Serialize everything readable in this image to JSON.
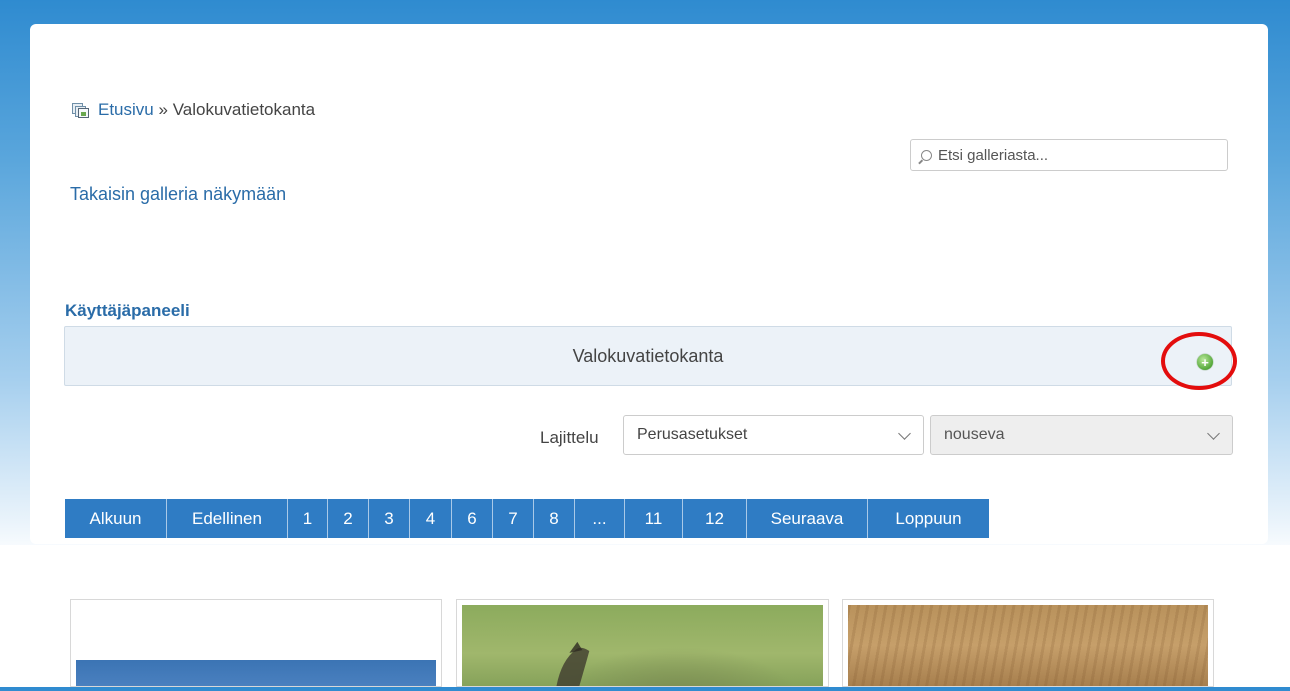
{
  "breadcrumb": {
    "home": "Etusivu",
    "separator": "»",
    "current": "Valokuvatietokanta"
  },
  "search": {
    "placeholder": "Etsi galleriasta..."
  },
  "back_link": "Takaisin galleria näkymään",
  "user_panel": {
    "heading": "Käyttäjäpaneeli",
    "title": "Valokuvatietokanta",
    "add_button": "+"
  },
  "sorting": {
    "label": "Lajittelu",
    "sort_by": "Perusasetukset",
    "order": "nouseva"
  },
  "pagination": [
    "Alkuun",
    "Edellinen",
    "1",
    "2",
    "3",
    "4",
    "6",
    "7",
    "8",
    "...",
    "11",
    "12",
    "Seuraava",
    "Loppuun"
  ],
  "colors": {
    "accent": "#2f7cc4",
    "link": "#2a6ca8",
    "highlight": "#e30d0d",
    "add_green": "#55a83a"
  },
  "icons": {
    "breadcrumb": "gallery-icon",
    "search": "search-icon",
    "add": "add-icon"
  }
}
